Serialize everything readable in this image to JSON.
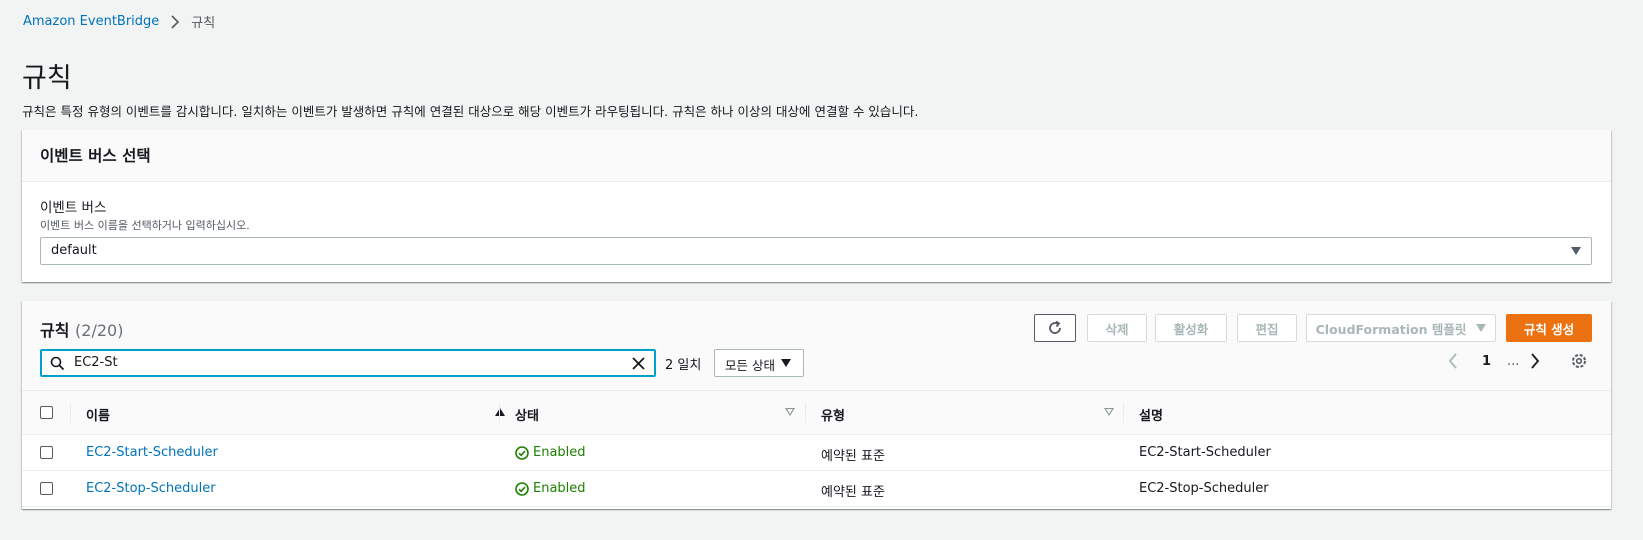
{
  "breadcrumb": {
    "root": "Amazon EventBridge",
    "current": "규칙"
  },
  "page": {
    "title": "규칙",
    "description": "규칙은 특정 유형의 이벤트를 감시합니다. 일치하는 이벤트가 발생하면 규칙에 연결된 대상으로 해당 이벤트가 라우팅됩니다. 규칙은 하나 이상의 대상에 연결할 수 있습니다."
  },
  "event_bus_panel": {
    "header": "이벤트 버스 선택",
    "label": "이벤트 버스",
    "description": "이벤트 버스 이름을 선택하거나 입력하십시오.",
    "selected": "default"
  },
  "rules_panel": {
    "title": "규칙",
    "count": "(2/20)",
    "buttons": {
      "delete": "삭제",
      "enable": "활성화",
      "edit": "편집",
      "cloudformation": "CloudFormation 템플릿",
      "create": "규칙 생성"
    },
    "search_value": "EC2-St",
    "match_text": "2 일치",
    "status_filter": "모든 상태",
    "pagination": {
      "current_page": "1",
      "ellipsis": "..."
    },
    "columns": [
      "이름",
      "상태",
      "유형",
      "설명"
    ],
    "rows": [
      {
        "name": "EC2-Start-Scheduler",
        "status": "Enabled",
        "type": "예약된 표준",
        "description": "EC2-Start-Scheduler"
      },
      {
        "name": "EC2-Stop-Scheduler",
        "status": "Enabled",
        "type": "예약된 표준",
        "description": "EC2-Stop-Scheduler"
      }
    ]
  },
  "colors": {
    "link": "#0073bb",
    "primary_button": "#ec7211",
    "success": "#1d8102",
    "focus": "#00a1c9"
  }
}
